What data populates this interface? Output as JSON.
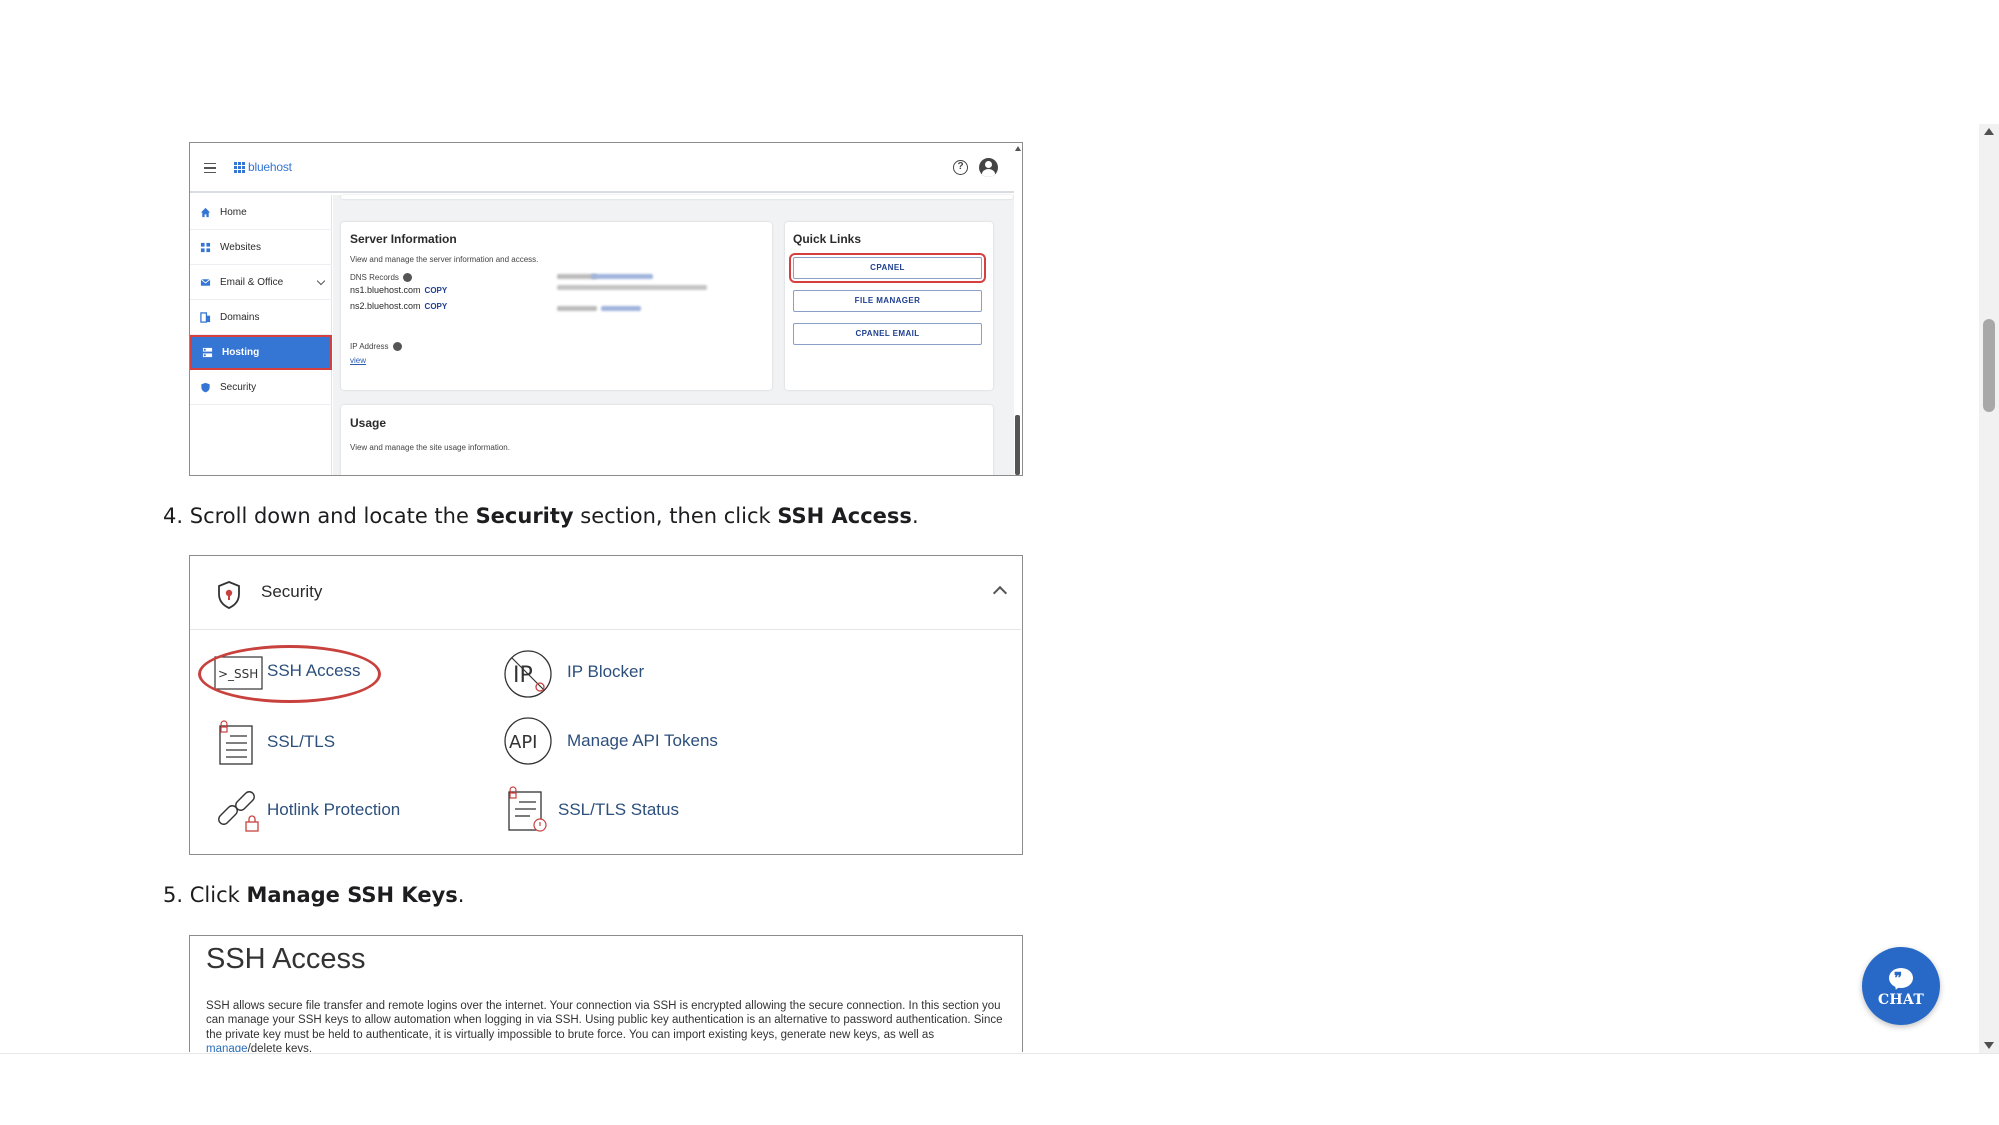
{
  "dashboard": {
    "logo": "bluehost",
    "sidebar": [
      {
        "label": "Home",
        "icon": "home-icon"
      },
      {
        "label": "Websites",
        "icon": "websites-icon"
      },
      {
        "label": "Email & Office",
        "icon": "email-icon"
      },
      {
        "label": "Domains",
        "icon": "domains-icon"
      },
      {
        "label": "Hosting",
        "icon": "hosting-icon"
      },
      {
        "label": "Security",
        "icon": "security-icon"
      }
    ],
    "active_item": "Hosting",
    "server_info": {
      "title": "Server Information",
      "description": "View and manage the server information and access.",
      "dns_label": "DNS Records",
      "ns1": "ns1.bluehost.com",
      "ns2": "ns2.bluehost.com",
      "copy": "COPY",
      "ip_label": "IP Address",
      "view": "view"
    },
    "quick_links": {
      "title": "Quick Links",
      "buttons": [
        "CPANEL",
        "FILE MANAGER",
        "CPANEL EMAIL"
      ]
    },
    "usage": {
      "title": "Usage",
      "description": "View and manage the site usage information."
    }
  },
  "steps": {
    "step4": {
      "num": "4.",
      "a": "Scroll down and locate the ",
      "b1": "Security",
      "c": " section, then click ",
      "b2": "SSH Access",
      "d": "."
    },
    "step5": {
      "num": "5.",
      "a": "Click ",
      "b1": "Manage SSH Keys",
      "d": "."
    }
  },
  "security_panel": {
    "title": "Security",
    "items": [
      {
        "label": "SSH Access",
        "icon": "ssh-icon"
      },
      {
        "label": "IP Blocker",
        "icon": "ip-blocker-icon"
      },
      {
        "label": "SSL/TLS",
        "icon": "ssl-tls-icon"
      },
      {
        "label": "Manage API Tokens",
        "icon": "api-icon"
      },
      {
        "label": "Hotlink Protection",
        "icon": "hotlink-icon"
      },
      {
        "label": "SSL/TLS Status",
        "icon": "ssl-status-icon"
      }
    ],
    "ssh_icon_text": ">_SSH",
    "api_icon_text": "API"
  },
  "ssh_access": {
    "title": "SSH Access",
    "body_1": "SSH allows secure file transfer and remote logins over the internet. Your connection via SSH is encrypted allowing the secure connection. In this section you can manage your SSH keys to allow automation when logging in via SSH. Using public key authentication is an alternative to password authentication. Since the private key must be held to authenticate, it is virtually impossible to brute force. You can import existing keys, generate new keys, as well as ",
    "link": "manage",
    "body_2": "/delete keys."
  },
  "chat": {
    "label": "CHAT"
  },
  "colors": {
    "accent": "#3575d3",
    "highlight": "#d63f3f",
    "link": "#2c4f7c",
    "chat": "#2869c7"
  }
}
